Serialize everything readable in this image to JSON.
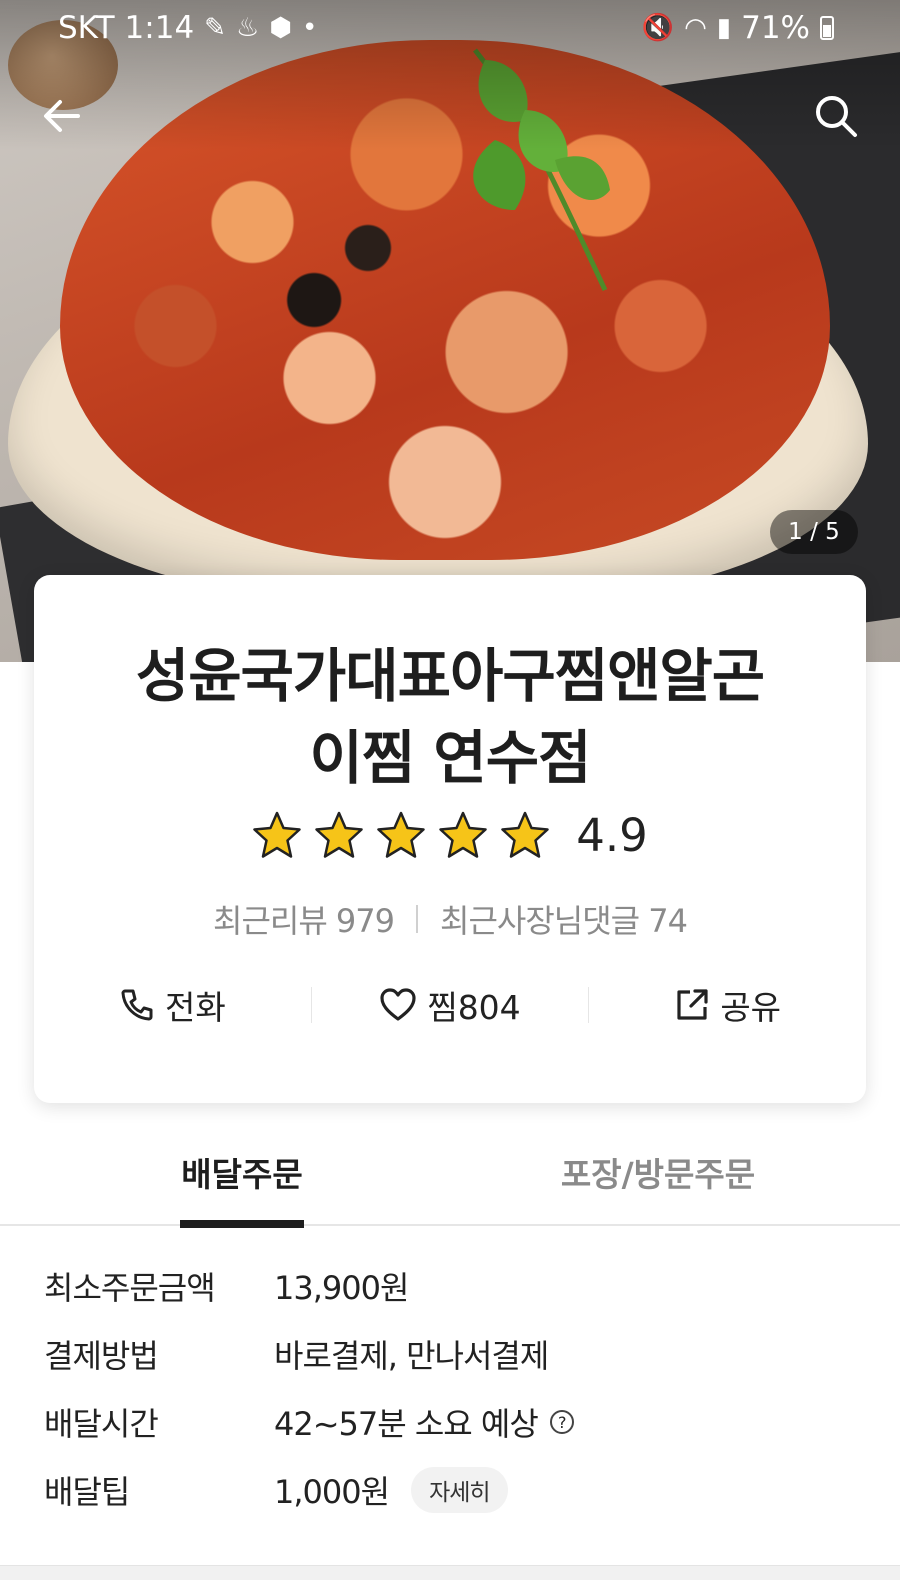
{
  "status_bar": {
    "carrier": "SKT",
    "time": "1:14",
    "battery": "71%"
  },
  "hero": {
    "page_indicator": "1 / 5"
  },
  "store": {
    "name_line1": "성윤국가대표아구찜앤알곤",
    "name_line2": "이찜 연수점",
    "rating": "4.9",
    "rating_stars": 5,
    "recent_reviews": "최근리뷰 979",
    "owner_comments": "최근사장님댓글 74"
  },
  "actions": {
    "call_label": "전화",
    "favorite_label": "찜804",
    "share_label": "공유"
  },
  "tabs": {
    "delivery": "배달주문",
    "pickup": "포장/방문주문"
  },
  "info": {
    "min_order_label": "최소주문금액",
    "min_order_value": "13,900원",
    "payment_label": "결제방법",
    "payment_value": "바로결제, 만나서결제",
    "delivery_time_label": "배달시간",
    "delivery_time_value": "42~57분 소요 예상",
    "delivery_tip_label": "배달팁",
    "delivery_tip_value": "1,000원",
    "detail_button": "자세히"
  },
  "colors": {
    "star": "#f6c418",
    "text_primary": "#1e1e1e",
    "text_secondary": "#8a8a8a"
  }
}
